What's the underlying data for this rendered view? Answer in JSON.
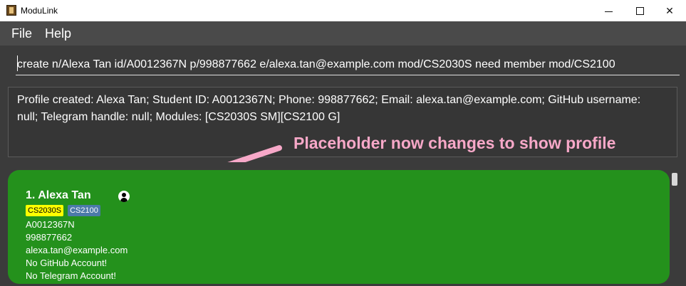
{
  "window": {
    "title": "ModuLink",
    "icons": [
      "app-icon",
      "minimize-icon",
      "maximize-icon",
      "close-icon"
    ]
  },
  "menu": {
    "file": "File",
    "help": "Help"
  },
  "command": {
    "value": "create n/Alexa Tan id/A0012367N p/998877662 e/alexa.tan@example.com mod/CS2030S need member mod/CS2100"
  },
  "result": {
    "text": "Profile created: Alexa Tan; Student ID: A0012367N; Phone: 998877662; Email: alexa.tan@example.com; GitHub username: null; Telegram handle: null; Modules: [CS2030S SM][CS2100 G]"
  },
  "annotation": {
    "text": "Placeholder now changes to show profile",
    "color": "#f7a8c8"
  },
  "profile": {
    "name": "1. Alexa Tan",
    "tags": [
      "CS2030S",
      "CS2100"
    ],
    "student_id": "A0012367N",
    "phone": "998877662",
    "email": "alexa.tan@example.com",
    "github": "No GitHub Account!",
    "telegram": "No Telegram Account!",
    "card_color": "#24911c"
  }
}
